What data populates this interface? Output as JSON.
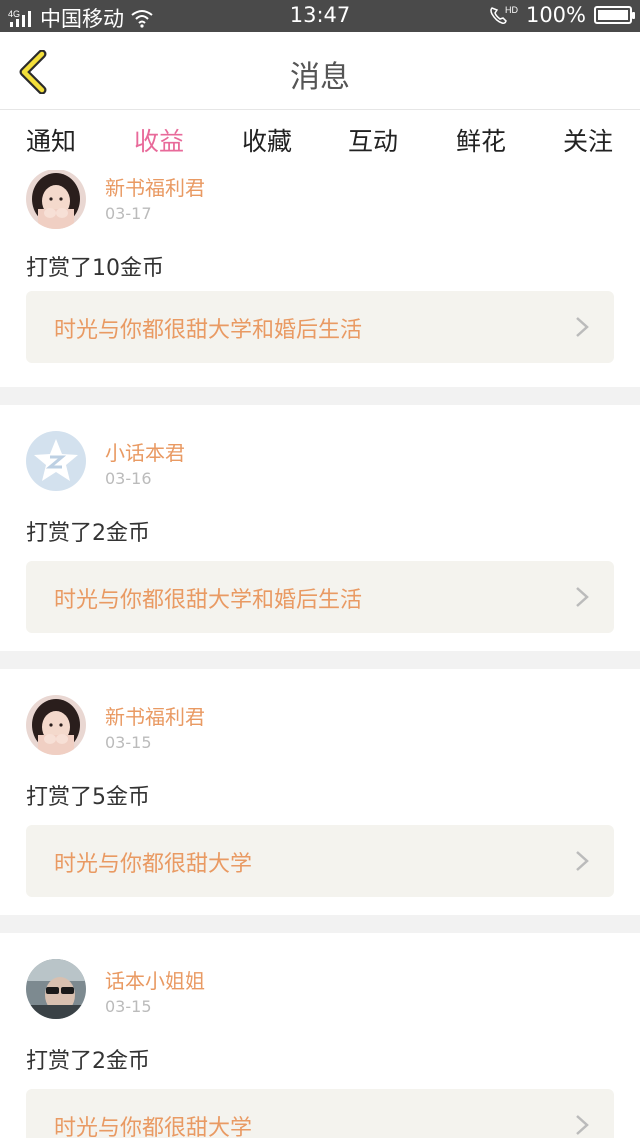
{
  "status_bar": {
    "network": "4G",
    "carrier": "中国移动",
    "time": "13:47",
    "hd": "HD",
    "battery": "100%"
  },
  "nav": {
    "title": "消息"
  },
  "tabs": [
    {
      "label": "通知"
    },
    {
      "label": "收益",
      "active": true
    },
    {
      "label": "收藏"
    },
    {
      "label": "互动"
    },
    {
      "label": "鲜花"
    },
    {
      "label": "关注"
    }
  ],
  "colors": {
    "accent_pink": "#e86a9a",
    "name_orange": "#e99a63",
    "book_bg": "#f4f3ee",
    "status_bar_bg": "#4a4a4a"
  },
  "messages": [
    {
      "user": "新书福利君",
      "date": "03-17",
      "reward": "打赏了10金币",
      "book": "时光与你都很甜大学和婚后生活",
      "avatar": "girl-avatar"
    },
    {
      "user": "小话本君",
      "date": "03-16",
      "reward": "打赏了2金币",
      "book": "时光与你都很甜大学和婚后生活",
      "avatar": "default-star-avatar"
    },
    {
      "user": "新书福利君",
      "date": "03-15",
      "reward": "打赏了5金币",
      "book": "时光与你都很甜大学",
      "avatar": "girl-avatar"
    },
    {
      "user": "话本小姐姐",
      "date": "03-15",
      "reward": "打赏了2金币",
      "book": "时光与你都很甜大学",
      "avatar": "sunglasses-avatar"
    }
  ]
}
